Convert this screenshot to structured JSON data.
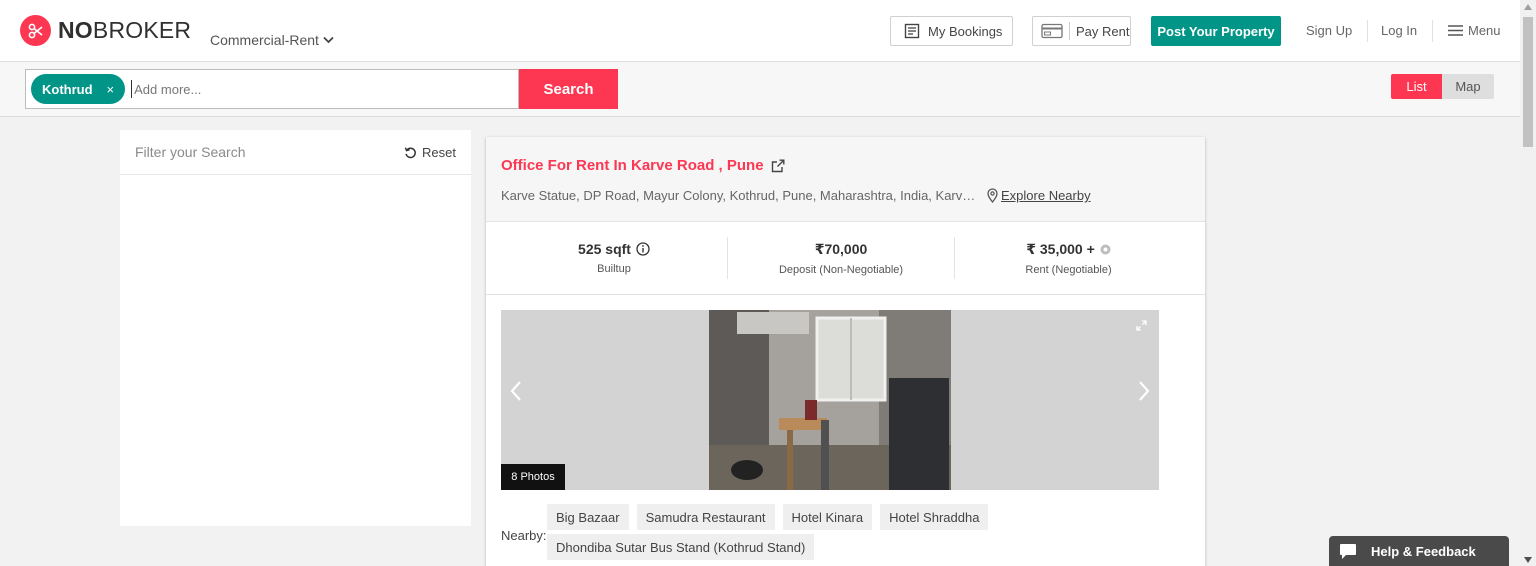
{
  "header": {
    "brand_bold": "NO",
    "brand_rest": "BROKER",
    "category": "Commercial-Rent",
    "my_bookings": "My Bookings",
    "pay_rent": "Pay Rent",
    "post_property": "Post Your Property",
    "sign_up": "Sign Up",
    "log_in": "Log In",
    "menu": "Menu"
  },
  "search": {
    "chip": "Kothrud",
    "chip_remove": "×",
    "placeholder": "Add more...",
    "button": "Search",
    "view_list": "List",
    "view_map": "Map"
  },
  "filter": {
    "title": "Filter your Search",
    "reset": "Reset"
  },
  "listing": {
    "title": "Office For Rent In Karve Road , Pune",
    "address": "Karve Statue, DP Road, Mayur Colony, Kothrud, Pune, Maharashtra, India, Karve Road, Pune",
    "explore": "Explore Nearby",
    "stats": [
      {
        "value": "525 sqft",
        "label": "Builtup"
      },
      {
        "value": "₹70,000",
        "label": "Deposit (Non-Negotiable)"
      },
      {
        "value": "₹ 35,000 +",
        "label": "Rent (Negotiable)"
      }
    ],
    "photos_badge": "8 Photos",
    "nearby_label": "Nearby:",
    "nearby": [
      "Big Bazaar",
      "Samudra Restaurant",
      "Hotel Kinara",
      "Hotel Shraddha",
      "Dhondiba Sutar Bus Stand (Kothrud Stand)"
    ]
  },
  "help": {
    "label": "Help & Feedback"
  },
  "colors": {
    "brand": "#fd3752",
    "teal": "#009587"
  }
}
